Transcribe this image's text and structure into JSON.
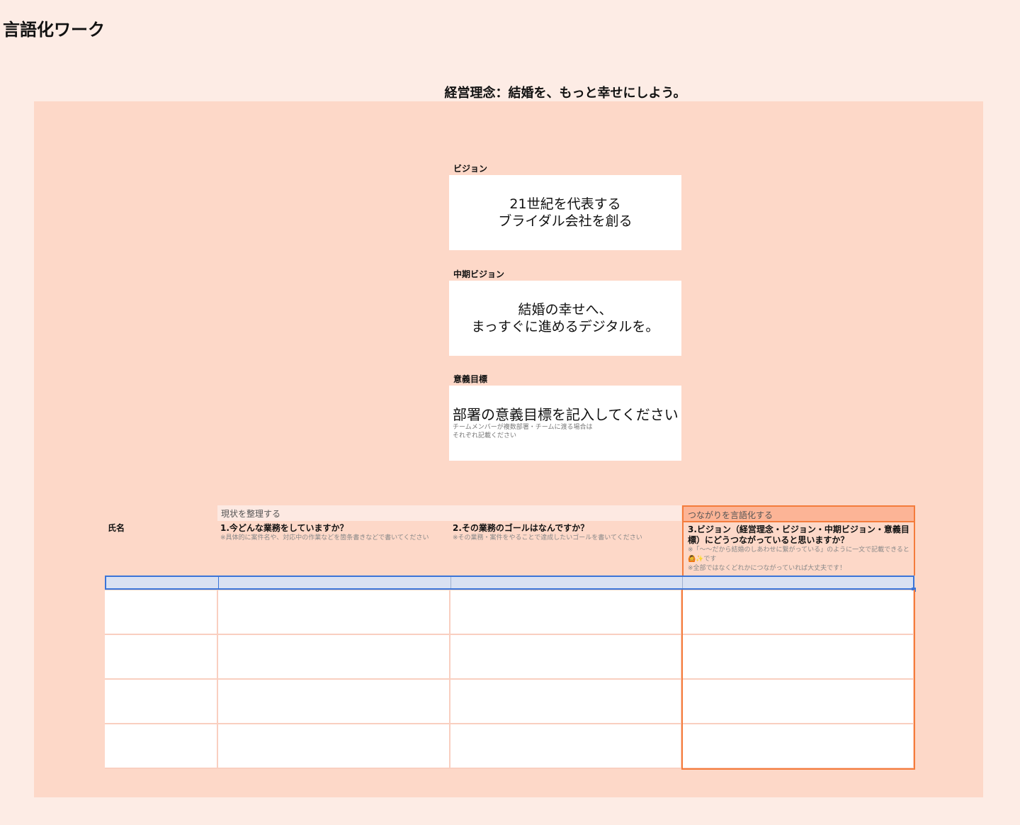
{
  "title": "言語化ワーク",
  "motto": "経営理念：結婚を、もっと幸せにしよう。",
  "vision": {
    "label": "ビジョン",
    "lines": [
      "21世紀を代表する",
      "ブライダル会社を創る"
    ]
  },
  "mid_vision": {
    "label": "中期ビジョン",
    "lines": [
      "結婚の幸せへ、",
      "まっすぐに進めるデジタルを。"
    ]
  },
  "goal": {
    "label": "意義目標",
    "main": "部署の意義目標を記入してください",
    "notes": [
      "チームメンバーが複数部署・チームに渡る場合は",
      "それぞれ記載ください"
    ]
  },
  "table": {
    "group1": "現状を整理する",
    "group2": "つながりを言語化する",
    "col_name": "氏名",
    "q1": {
      "title": "1.今どんな業務をしていますか？",
      "note": "※具体的に案件名や、対応中の作業などを箇条書きなどで書いてください"
    },
    "q2": {
      "title": "2.その業務のゴールはなんですか？",
      "note": "※その業務・案件をやることで達成したいゴールを書いてください"
    },
    "q3": {
      "title": "3.ビジョン（経営理念・ビジョン・中期ビジョン・意義目標）にどうつながっていると思いますか？",
      "note1": "※「〜〜だから結婚のしあわせに繋がっている」のように一文で記載できると🙆✨です",
      "note2": "※全部ではなくどれかにつながっていれば大丈夫です！"
    }
  },
  "colors": {
    "panel": "#fdd8c8",
    "accent": "#f47c3c",
    "selection": "#d9e1f2"
  }
}
